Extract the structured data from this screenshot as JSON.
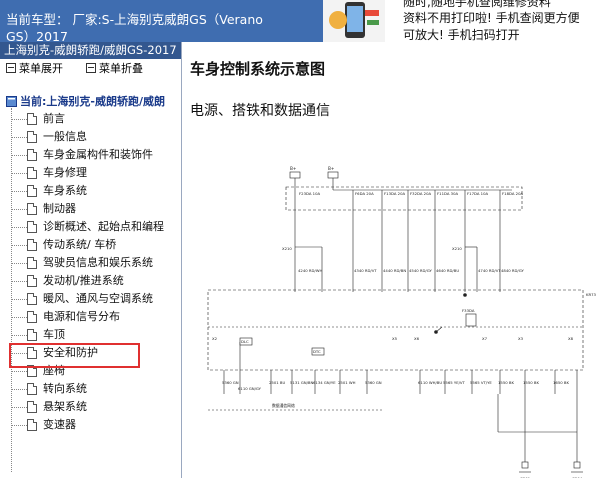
{
  "header": {
    "car_model_line1": "当前车型：  厂家:S-上海别克威朗GS（Verano",
    "car_model_line2": "GS）2017"
  },
  "ad": {
    "line1": "随时,随地手机查阅维修资料",
    "line2": "资料不用打印啦! 手机查阅更方便",
    "line3": "可放大! 手机扫码打开"
  },
  "sidebar": {
    "title": "上海别克-威朗轿跑/威朗GS-2017",
    "expand_label": "菜单展开",
    "collapse_label": "菜单折叠",
    "root_label": "当前:上海别克-威朗轿跑/威朗",
    "items": [
      {
        "label": "前言"
      },
      {
        "label": "一般信息"
      },
      {
        "label": "车身金属构件和装饰件"
      },
      {
        "label": "车身修理"
      },
      {
        "label": "车身系统"
      },
      {
        "label": "制动器"
      },
      {
        "label": "诊断概述、起始点和编程"
      },
      {
        "label": "传动系统/ 车桥"
      },
      {
        "label": "驾驶员信息和娱乐系统"
      },
      {
        "label": "发动机/推进系统"
      },
      {
        "label": "暖风、通风与空调系统"
      },
      {
        "label": "电源和信号分布"
      },
      {
        "label": "车顶"
      },
      {
        "label": "安全和防护"
      },
      {
        "label": "座椅"
      },
      {
        "label": "转向系统"
      },
      {
        "label": "悬架系统"
      },
      {
        "label": "变速器"
      }
    ],
    "selected_index": 11
  },
  "main": {
    "title": "车身控制系统示意图",
    "section": "电源、搭铁和数据通信"
  },
  "diagram": {
    "top_boxes": [
      "B+",
      "B+"
    ],
    "fuses": [
      "F23DA 10A",
      "F6DA 20A",
      "F13DA 20A",
      "F32DA 20A",
      "F11DA 30A",
      "F17DA 10A",
      "F18DA 20A"
    ],
    "top_wires": [
      "4240 RD/WH",
      "4340 RD/VT",
      "4440 RD/BN",
      "4540 RD/GY",
      "4640 RD/BU",
      "4740 RD/VT",
      "4840 RD/GY"
    ],
    "splices": [
      "X210",
      "X210"
    ],
    "bottom_wires": [
      "5360 GN",
      "6110 GN/GY",
      "2501 BU",
      "5131 GN/BN",
      "6134 GN/YE",
      "2501 WH",
      "5360 GN",
      "6110 WH/BU",
      "5565 YE/VT",
      "5565 VT/YE",
      "1550 BK",
      "1550 BK",
      "1650 BK"
    ],
    "connectors": [
      "X2",
      "X5",
      "X6",
      "X7",
      "X3",
      "X8"
    ],
    "labels": [
      "KR73",
      "F33DA",
      "DLC",
      "DTC"
    ],
    "grounds": [
      "G201",
      "G204"
    ],
    "note": "数据通信网络"
  }
}
